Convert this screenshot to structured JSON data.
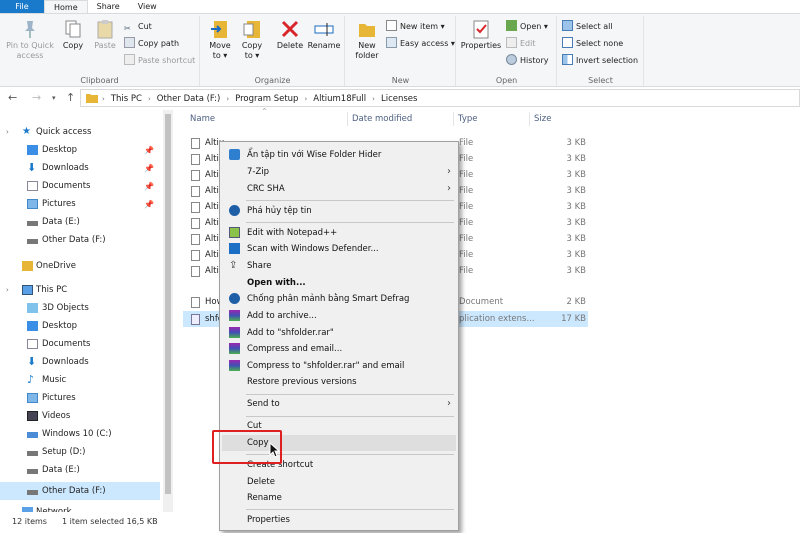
{
  "tabs": [
    "File",
    "Home",
    "Share",
    "View"
  ],
  "ribbon": {
    "clipboard": {
      "label": "Clipboard",
      "pin": "Pin to Quick access",
      "copy": "Copy",
      "paste": "Paste",
      "cut": "Cut",
      "copy_path": "Copy path",
      "paste_shortcut": "Paste shortcut"
    },
    "organize": {
      "label": "Organize",
      "move_to": "Move to",
      "copy_to": "Copy to",
      "delete": "Delete",
      "rename": "Rename"
    },
    "new": {
      "label": "New",
      "new_folder": "New folder",
      "new_item": "New item",
      "easy_access": "Easy access"
    },
    "open": {
      "label": "Open",
      "properties": "Properties",
      "open": "Open",
      "edit": "Edit",
      "history": "History"
    },
    "select": {
      "label": "Select",
      "select_all": "Select all",
      "select_none": "Select none",
      "invert": "Invert selection"
    }
  },
  "address": {
    "crumbs": [
      "This PC",
      "Other Data (F:)",
      "Program Setup",
      "Altium18Full",
      "Licenses"
    ]
  },
  "sidebar": {
    "items": [
      {
        "label": "Quick access",
        "pinned": false
      },
      {
        "label": "Desktop",
        "pinned": true
      },
      {
        "label": "Downloads",
        "pinned": true
      },
      {
        "label": "Documents",
        "pinned": true
      },
      {
        "label": "Pictures",
        "pinned": true
      },
      {
        "label": "Data (E:)",
        "pinned": false
      },
      {
        "label": "Other Data (F:)",
        "pinned": false
      },
      {
        "label": "OneDrive",
        "pinned": false
      },
      {
        "label": "This PC",
        "pinned": false
      },
      {
        "label": "3D Objects",
        "pinned": false
      },
      {
        "label": "Desktop",
        "pinned": false
      },
      {
        "label": "Documents",
        "pinned": false
      },
      {
        "label": "Downloads",
        "pinned": false
      },
      {
        "label": "Music",
        "pinned": false
      },
      {
        "label": "Pictures",
        "pinned": false
      },
      {
        "label": "Videos",
        "pinned": false
      },
      {
        "label": "Windows 10 (C:)",
        "pinned": false
      },
      {
        "label": "Setup (D:)",
        "pinned": false
      },
      {
        "label": "Data (E:)",
        "pinned": false
      },
      {
        "label": "Other Data (F:)",
        "pinned": false
      },
      {
        "label": "Network",
        "pinned": false
      }
    ]
  },
  "columns": {
    "name": "Name",
    "date": "Date modified",
    "type": "Type",
    "size": "Size"
  },
  "files": [
    {
      "name": "Altiu",
      "type": "File",
      "size": "3 KB"
    },
    {
      "name": "Alti",
      "type": "File",
      "size": "3 KB"
    },
    {
      "name": "Alti",
      "type": "File",
      "size": "3 KB"
    },
    {
      "name": "Alti",
      "type": "File",
      "size": "3 KB"
    },
    {
      "name": "Alti",
      "type": "File",
      "size": "3 KB"
    },
    {
      "name": "Alti",
      "type": "File",
      "size": "3 KB"
    },
    {
      "name": "Alti",
      "type": "File",
      "size": "3 KB"
    },
    {
      "name": "Alti",
      "type": "File",
      "size": "3 KB"
    },
    {
      "name": "Alti",
      "type": "File",
      "size": "3 KB"
    },
    {
      "name": "How",
      "type": "Document",
      "size": "2 KB"
    },
    {
      "name": "shfo",
      "type": "plication extens...",
      "size": "17 KB"
    }
  ],
  "context_menu": {
    "items": [
      "Ẩn tập tin với Wise Folder Hider",
      "7-Zip",
      "CRC SHA",
      "Phá hủy tệp tin",
      "Edit with Notepad++",
      "Scan with Windows Defender...",
      "Share",
      "Open with...",
      "Chống phân mảnh bằng Smart Defrag",
      "Add to archive...",
      "Add to \"shfolder.rar\"",
      "Compress and email...",
      "Compress to \"shfolder.rar\" and email",
      "Restore previous versions",
      "Send to",
      "Cut",
      "Copy",
      "Create shortcut",
      "Delete",
      "Rename",
      "Properties"
    ]
  },
  "status": {
    "count": "12 items",
    "selection": "1 item selected  16,5 KB"
  },
  "colors": {
    "accent": "#1979ca",
    "selection": "#cce8ff",
    "highlight_box": "#e02020",
    "folder": "#e8b637"
  }
}
